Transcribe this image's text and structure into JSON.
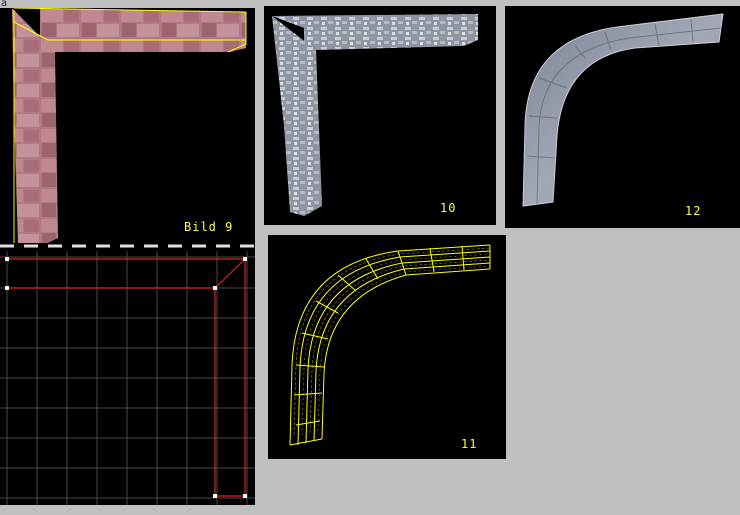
{
  "corner_mark": "a",
  "panels": {
    "bild9": {
      "label": "Bild 9"
    },
    "view10": {
      "label": "10"
    },
    "view12": {
      "label": "12"
    },
    "view11": {
      "label": "11"
    },
    "grid": {
      "label": ""
    }
  },
  "colors": {
    "background": "#c0c0c0",
    "viewport": "#000000",
    "label": "#ffff40",
    "wireframe_yellow": "#ffff00",
    "grid_line": "#4a4a4a",
    "grid_red": "#e02020",
    "stone_pink": "#b87c86",
    "stone_grey": "#9aa0ae"
  }
}
